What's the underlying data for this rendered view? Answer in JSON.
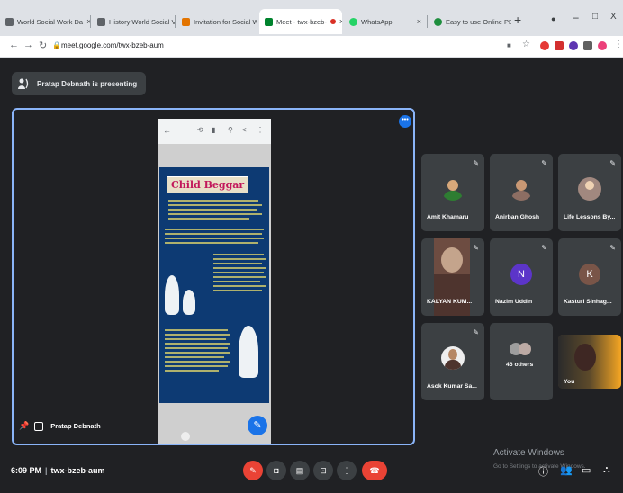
{
  "browser": {
    "tabs": [
      {
        "label": "World Social Work Da",
        "color": "#5f6368"
      },
      {
        "label": "History World Social V",
        "color": "#5f6368"
      },
      {
        "label": "Invitation for Social W",
        "color": "#e37400"
      },
      {
        "label": "Meet - twx-bzeb-",
        "color": "#00832d"
      },
      {
        "label": "WhatsApp",
        "color": "#25d366"
      },
      {
        "label": "Easy to use Online PD",
        "color": "#1e8e3e"
      }
    ],
    "new_tab": "+",
    "minimize": "–",
    "maximize": "□",
    "close": "X",
    "url": "meet.google.com/twx-bzeb-aum"
  },
  "meet": {
    "presenting_banner": "Pratap Debnath is presenting",
    "presenter_name": "Pratap Debnath",
    "doc_title": "Child Beggar",
    "participants": [
      {
        "name": "Amit Khamaru",
        "type": "photo",
        "color": "#2e7d32"
      },
      {
        "name": "Anirban Ghosh",
        "type": "photo",
        "color": "#8d6e63"
      },
      {
        "name": "Life Lessons By...",
        "type": "photo",
        "color": "#a1887f"
      },
      {
        "name": "KALYAN KUM...",
        "type": "video",
        "color": "#6d4c41"
      },
      {
        "name": "Nazim Uddin",
        "type": "initial",
        "initial": "N"
      },
      {
        "name": "Kasturi Sinhag...",
        "type": "initial",
        "initial": "K"
      },
      {
        "name": "Asok Kumar Sa...",
        "type": "photo",
        "color": "#4e342e"
      },
      {
        "name": "46 others",
        "type": "group"
      },
      {
        "name": "You",
        "type": "video",
        "color": "#f5a623"
      }
    ],
    "time": "6:09 PM",
    "meeting_code": "twx-bzeb-aum",
    "watermark_title": "Activate Windows",
    "watermark_sub": "Go to Settings to activate Windows."
  }
}
